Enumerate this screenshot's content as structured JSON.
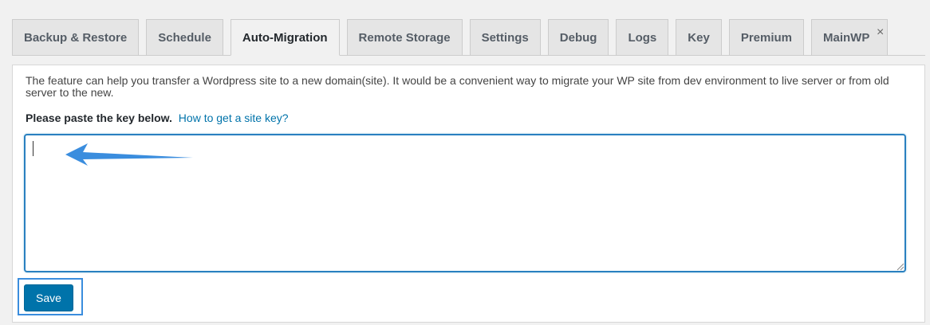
{
  "tabs": [
    {
      "label": "Backup & Restore",
      "active": false
    },
    {
      "label": "Schedule",
      "active": false
    },
    {
      "label": "Auto-Migration",
      "active": true
    },
    {
      "label": "Remote Storage",
      "active": false
    },
    {
      "label": "Settings",
      "active": false
    },
    {
      "label": "Debug",
      "active": false
    },
    {
      "label": "Logs",
      "active": false
    },
    {
      "label": "Key",
      "active": false
    },
    {
      "label": "Premium",
      "active": false
    },
    {
      "label": "MainWP",
      "active": false,
      "close_glyph": "×"
    }
  ],
  "panel": {
    "description": "The feature can help you transfer a Wordpress site to a new domain(site). It would be a convenient way to migrate your WP site from dev environment to live server or from old server to the new.",
    "prompt_label": "Please paste the key below.",
    "help_link": "How to get a site key?",
    "key_value": "",
    "save_label": "Save"
  },
  "colors": {
    "accent": "#0073aa",
    "highlight": "#3a8dde",
    "arrow": "#3a8dde"
  }
}
